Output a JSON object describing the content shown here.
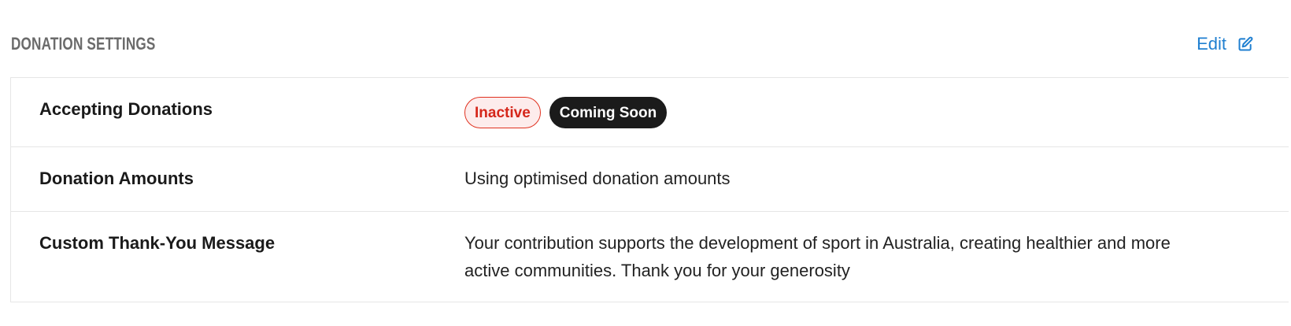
{
  "section": {
    "title": "DONATION SETTINGS",
    "edit_label": "Edit",
    "edit_icon": "edit-icon"
  },
  "rows": [
    {
      "label": "Accepting Donations",
      "badges": [
        {
          "label": "Inactive",
          "color": "#d5261a",
          "background": "#fdecec"
        },
        {
          "label": "Coming Soon",
          "color": "#ffffff",
          "background": "#1b1b1b"
        }
      ]
    },
    {
      "label": "Donation Amounts",
      "value": "Using optimised donation amounts"
    },
    {
      "label": "Custom Thank-You Message",
      "value": "Your contribution supports the development of sport in Australia, creating healthier and more active communities. Thank you for your generosity"
    }
  ],
  "colors": {
    "accent": "#1f7fd0",
    "heading": "#6b6b6b",
    "border": "#e6e6e6"
  }
}
